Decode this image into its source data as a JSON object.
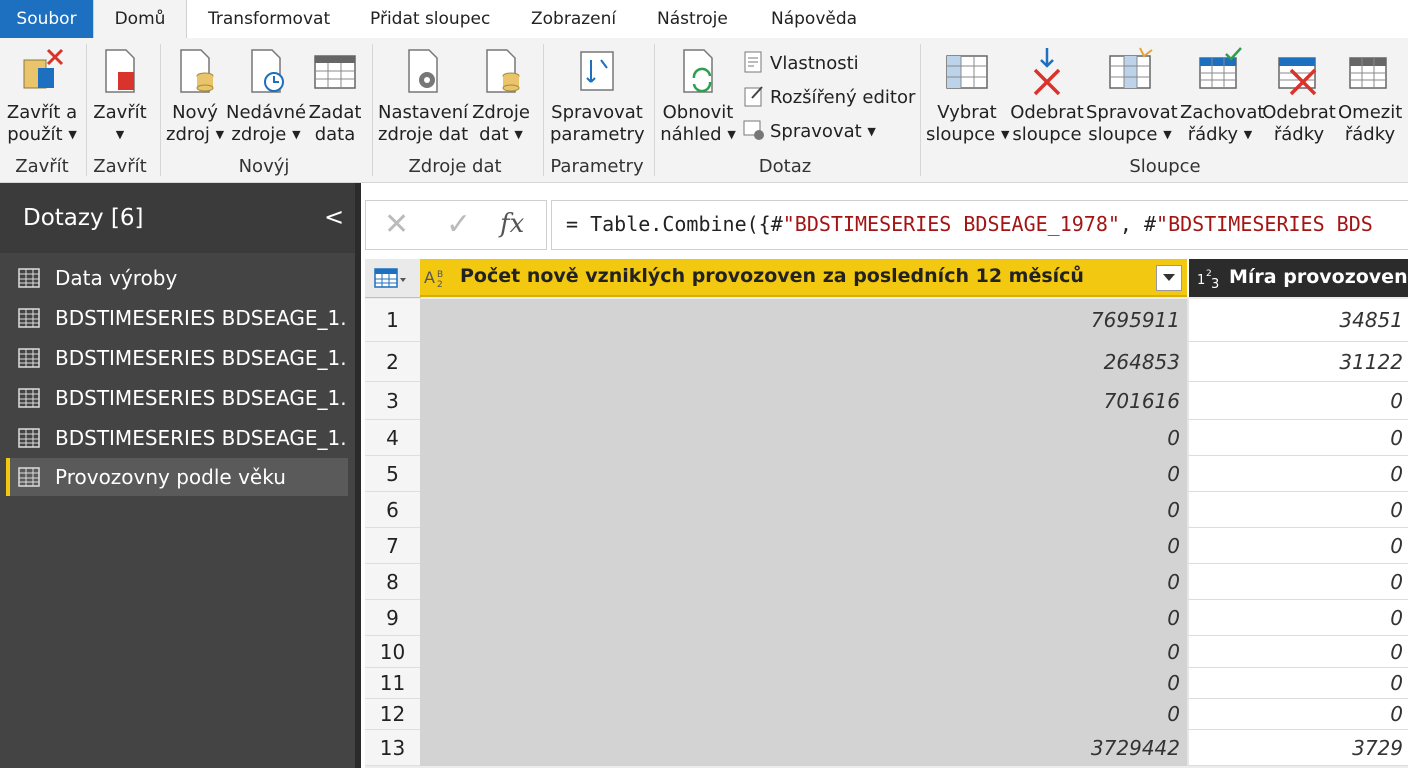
{
  "menu": {
    "file": "Soubor",
    "tabs": [
      "Domů",
      "Transformovat",
      "Přidat sloupec",
      "Zobrazení",
      "Nástroje",
      "Nápověda"
    ]
  },
  "ribbon": {
    "close_apply": [
      "Zavřít a",
      "použít"
    ],
    "close": "Zavřít",
    "new_source": [
      "Nový",
      "zdroj"
    ],
    "recent_sources": [
      "Nedávné",
      "zdroje"
    ],
    "enter_data": [
      "Zadat",
      "data"
    ],
    "source_settings": [
      "Nastavení",
      "zdroje dat"
    ],
    "data_sources": [
      "Zdroje",
      "dat"
    ],
    "manage_params": [
      "Spravovat",
      "parametry"
    ],
    "refresh_preview": [
      "Obnovit",
      "náhled"
    ],
    "properties": "Vlastnosti",
    "advanced_editor": "Rozšířený editor",
    "manage": "Spravovat",
    "choose_columns": [
      "Vybrat",
      "sloupce"
    ],
    "remove_columns": [
      "Odebrat",
      "sloupce"
    ],
    "manage_columns": [
      "Spravovat",
      "sloupce"
    ],
    "keep_rows": [
      "Zachovat",
      "řádky"
    ],
    "remove_rows": [
      "Odebrat",
      "řádky"
    ],
    "limit_rows": [
      "Omezit",
      "řádky"
    ],
    "groups": {
      "close1": "Zavřít",
      "close2": "Zavřít",
      "new": "Novýj",
      "data_sources": "Zdroje dat",
      "parameters": "Parametry",
      "query": "Dotaz",
      "columns": "Sloupce"
    }
  },
  "queries": {
    "title": "Dotazy [6]",
    "collapse": "<",
    "items": [
      "Data výroby",
      "BDSTIMESERIES BDSEAGE_1...",
      "BDSTIMESERIES BDSEAGE_1...",
      "BDSTIMESERIES BDSEAGE_1...",
      "BDSTIMESERIES BDSEAGE_1...",
      "Provozovny podle věku"
    ]
  },
  "formula": {
    "cancel": "✕",
    "confirm": "✓",
    "fx": "fx",
    "prefix": "= Table.Combine({#",
    "str1": "\"BDSTIMESERIES BDSEAGE_1978\"",
    "sep": ", #",
    "str2": "\"BDSTIMESERIES BDS"
  },
  "table": {
    "col1_type": "ABC 123",
    "col1_name": "Počet nově vzniklých provozoven za posledních 12 měsíců",
    "col2_name": "Míra provozoven b",
    "rows": [
      {
        "n": "1",
        "a": "7695911",
        "b": "34851"
      },
      {
        "n": "2",
        "a": "264853",
        "b": "31122"
      },
      {
        "n": "3",
        "a": "701616",
        "b": "0"
      },
      {
        "n": "4",
        "a": "0",
        "b": "0"
      },
      {
        "n": "5",
        "a": "0",
        "b": "0"
      },
      {
        "n": "6",
        "a": "0",
        "b": "0"
      },
      {
        "n": "7",
        "a": "0",
        "b": "0"
      },
      {
        "n": "8",
        "a": "0",
        "b": "0"
      },
      {
        "n": "9",
        "a": "0",
        "b": "0"
      },
      {
        "n": "10",
        "a": "0",
        "b": "0"
      },
      {
        "n": "11",
        "a": "0",
        "b": "0"
      },
      {
        "n": "12",
        "a": "0",
        "b": "0"
      },
      {
        "n": "13",
        "a": "3729442",
        "b": "3729"
      }
    ]
  },
  "colors": {
    "accent": "#1d6fbf",
    "selected_header": "#f2c811",
    "panel": "#444444"
  }
}
